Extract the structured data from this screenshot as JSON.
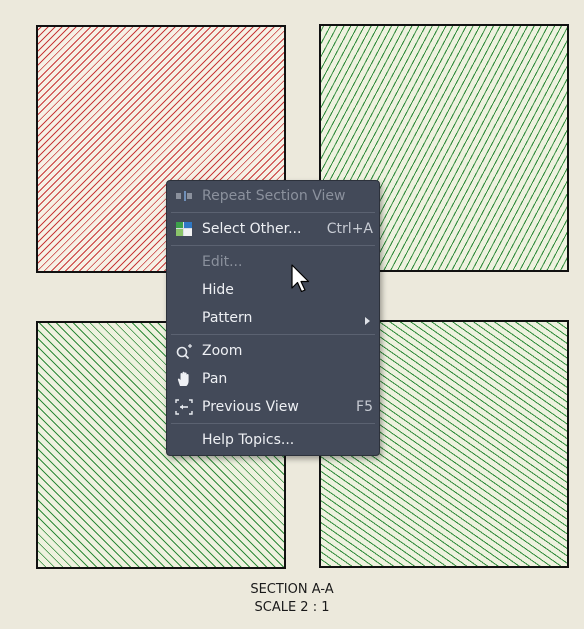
{
  "drawing": {
    "caption_line1": "SECTION A-A",
    "caption_line2": "SCALE 2 : 1"
  },
  "colors": {
    "hatch_red": "#c83a3a",
    "hatch_green": "#2f8a3a",
    "menu_bg": "#434a59",
    "background": "#ece9dc"
  },
  "context_menu": {
    "items": [
      {
        "label": "Repeat Section View",
        "shortcut": "",
        "icon": "repeat-section-view-icon",
        "enabled": false
      },
      {
        "label": "Select Other...",
        "shortcut": "Ctrl+A",
        "icon": "select-other-icon",
        "enabled": true
      },
      {
        "label": "Edit...",
        "shortcut": "",
        "icon": "",
        "enabled": false
      },
      {
        "label": "Hide",
        "shortcut": "",
        "icon": "",
        "enabled": true
      },
      {
        "label": "Pattern",
        "shortcut": "",
        "icon": "",
        "enabled": true,
        "submenu": true
      },
      {
        "label": "Zoom",
        "shortcut": "",
        "icon": "zoom-icon",
        "enabled": true
      },
      {
        "label": "Pan",
        "shortcut": "",
        "icon": "pan-hand-icon",
        "enabled": true
      },
      {
        "label": "Previous View",
        "shortcut": "F5",
        "icon": "previous-view-icon",
        "enabled": true
      },
      {
        "label": "Help Topics...",
        "shortcut": "",
        "icon": "",
        "enabled": true
      }
    ]
  }
}
